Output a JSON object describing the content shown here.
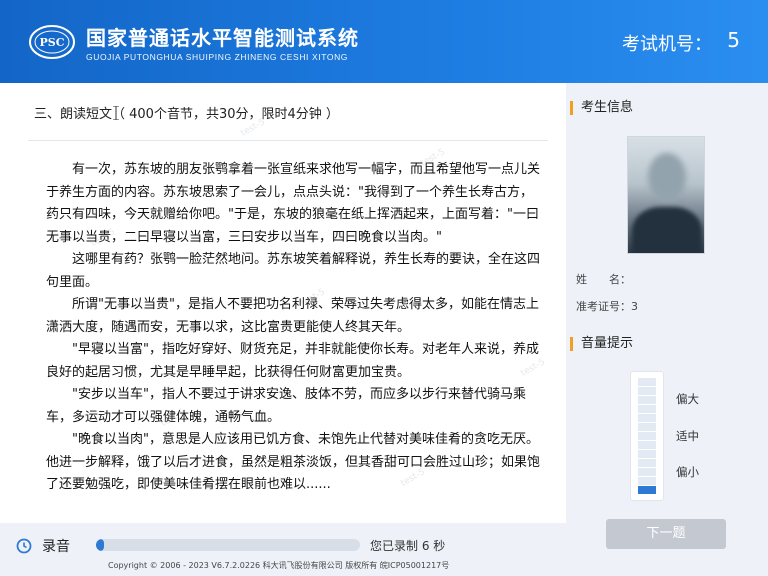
{
  "header": {
    "logo_text": "PSC",
    "title": "国家普通话水平智能测试系统",
    "subtitle": "GUOJIA PUTONGHUA SHUIPING ZHINENG CESHI XITONG",
    "exam_machine_label": "考试机号：",
    "exam_machine_number": "5"
  },
  "section": {
    "title": "三、朗读短文（ 400个音节，共30分，限时4分钟 ）"
  },
  "passage": {
    "paragraphs": [
      "有一次，苏东坡的朋友张鹗拿着一张宣纸来求他写一幅字，而且希望他写一点儿关于养生方面的内容。苏东坡思索了一会儿，点点头说：\"我得到了一个养生长寿古方，药只有四味，今天就赠给你吧。\"于是，东坡的狼毫在纸上挥洒起来，上面写着：\"一曰无事以当贵，二曰早寝以当富，三曰安步以当车，四曰晚食以当肉。\"",
      "这哪里有药？张鹗一脸茫然地问。苏东坡笑着解释说，养生长寿的要诀，全在这四句里面。",
      "所谓\"无事以当贵\"，是指人不要把功名利禄、荣辱过失考虑得太多，如能在情志上潇洒大度，随遇而安，无事以求，这比富贵更能使人终其天年。",
      "\"早寝以当富\"，指吃好穿好、财货充足，并非就能使你长寿。对老年人来说，养成良好的起居习惯，尤其是早睡早起，比获得任何财富更加宝贵。",
      "\"安步以当车\"，指人不要过于讲求安逸、肢体不劳，而应多以步行来替代骑马乘车，多运动才可以强健体魄，通畅气血。",
      "\"晚食以当肉\"，意思是人应该用已饥方食、未饱先止代替对美味佳肴的贪吃无厌。他进一步解释，饿了以后才进食，虽然是粗茶淡饭，但其香甜可口会胜过山珍；如果饱了还要勉强吃，即使美味佳肴摆在眼前也难以......"
    ]
  },
  "sidebar": {
    "candidate_info_title": "考生信息",
    "name_label": "姓　　名：",
    "name_value": "",
    "id_label": "准考证号：",
    "id_value": "3",
    "volume_title": "音量提示",
    "volume_level_bars": 1,
    "volume_total_bars": 13,
    "vol_high": "偏大",
    "vol_mid": "适中",
    "vol_low": "偏小",
    "next_button": "下一题"
  },
  "recording": {
    "label": "录音",
    "progress": 0.01,
    "status": "您已录制 6 秒"
  },
  "footer": {
    "copyright": "Copyright © 2006 - 2023 V6.7.2.0226 科大讯飞股份有限公司 版权所有 皖ICP05001217号"
  },
  "watermark": "test-5",
  "colors": {
    "header_blue": "#1d7be0",
    "accent_orange": "#f0a020",
    "progress_blue": "#2e79d4"
  }
}
